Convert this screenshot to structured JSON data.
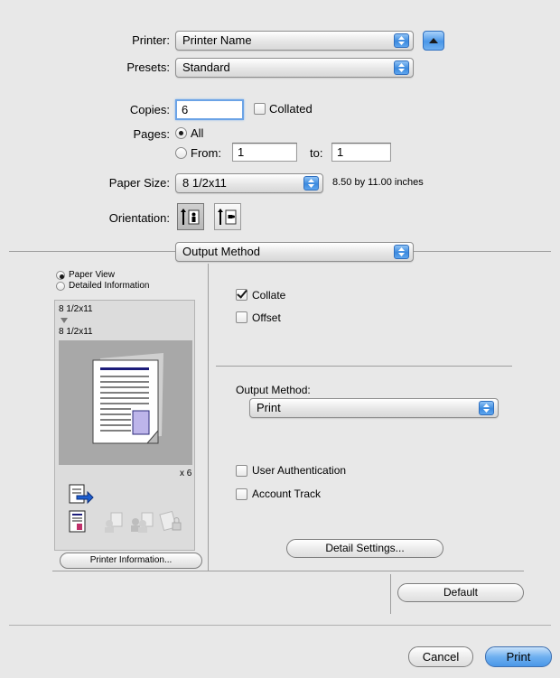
{
  "printer": {
    "label": "Printer:",
    "value": "Printer Name"
  },
  "presets": {
    "label": "Presets:",
    "value": "Standard"
  },
  "copies": {
    "label": "Copies:",
    "value": "6",
    "collated_label": "Collated"
  },
  "pages": {
    "label": "Pages:",
    "all_label": "All",
    "from_label": "From:",
    "from_value": "1",
    "to_label": "to:",
    "to_value": "1"
  },
  "paper_size": {
    "label": "Paper Size:",
    "value": "8 1/2x11",
    "dimensions": "8.50 by 11.00 inches"
  },
  "orientation": {
    "label": "Orientation:"
  },
  "panel_select": {
    "value": "Output Method"
  },
  "preview": {
    "paper_view_label": "Paper View",
    "detailed_info_label": "Detailed Information",
    "paper_in": "8 1/2x11",
    "paper_out": "8 1/2x11",
    "copies_badge": "x 6",
    "printer_info_button": "Printer Information..."
  },
  "options": {
    "collate_label": "Collate",
    "offset_label": "Offset",
    "output_method_label": "Output Method:",
    "output_method_value": "Print",
    "user_auth_label": "User Authentication",
    "account_track_label": "Account Track",
    "detail_settings_button": "Detail Settings...",
    "default_button": "Default"
  },
  "footer": {
    "cancel_button": "Cancel",
    "print_button": "Print"
  },
  "colors": {
    "accent": "#3b89de",
    "focus": "#6ba3e6",
    "preview_bg": "#a8a8a8"
  }
}
